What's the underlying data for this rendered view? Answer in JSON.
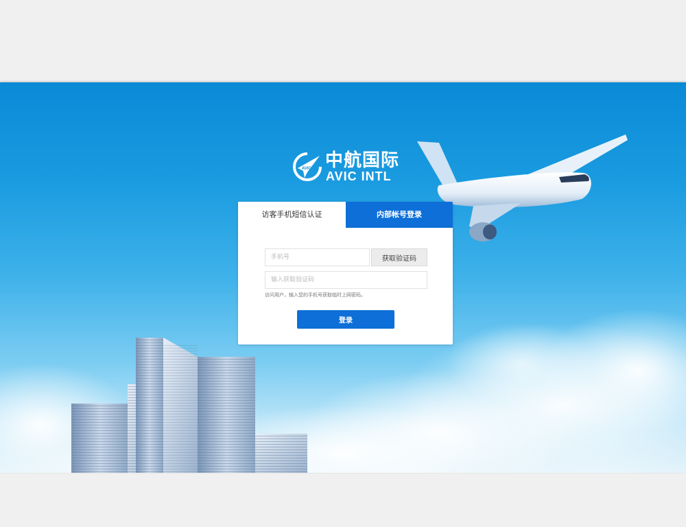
{
  "brand": {
    "name_cn": "中航国际",
    "name_en": "AVIC  INTL",
    "emblem_text": "AVIC"
  },
  "tabs": [
    {
      "label": "访客手机短信认证",
      "active": false
    },
    {
      "label": "内部帐号登录",
      "active": true
    }
  ],
  "form": {
    "phone_placeholder": "手机号",
    "get_code_label": "获取验证码",
    "code_placeholder": "输入获取验证码",
    "hint": "访问用户，输入您的手机号获取临时上网密码。",
    "login_label": "登录"
  },
  "colors": {
    "accent": "#0d6fd7",
    "sky_top": "#0a8ad6",
    "sky_bottom": "#e6f4fb",
    "page_bg": "#f0f0f0"
  },
  "icons": [
    "avic-emblem-icon",
    "airplane-illustration",
    "buildings-illustration",
    "clouds-illustration"
  ]
}
